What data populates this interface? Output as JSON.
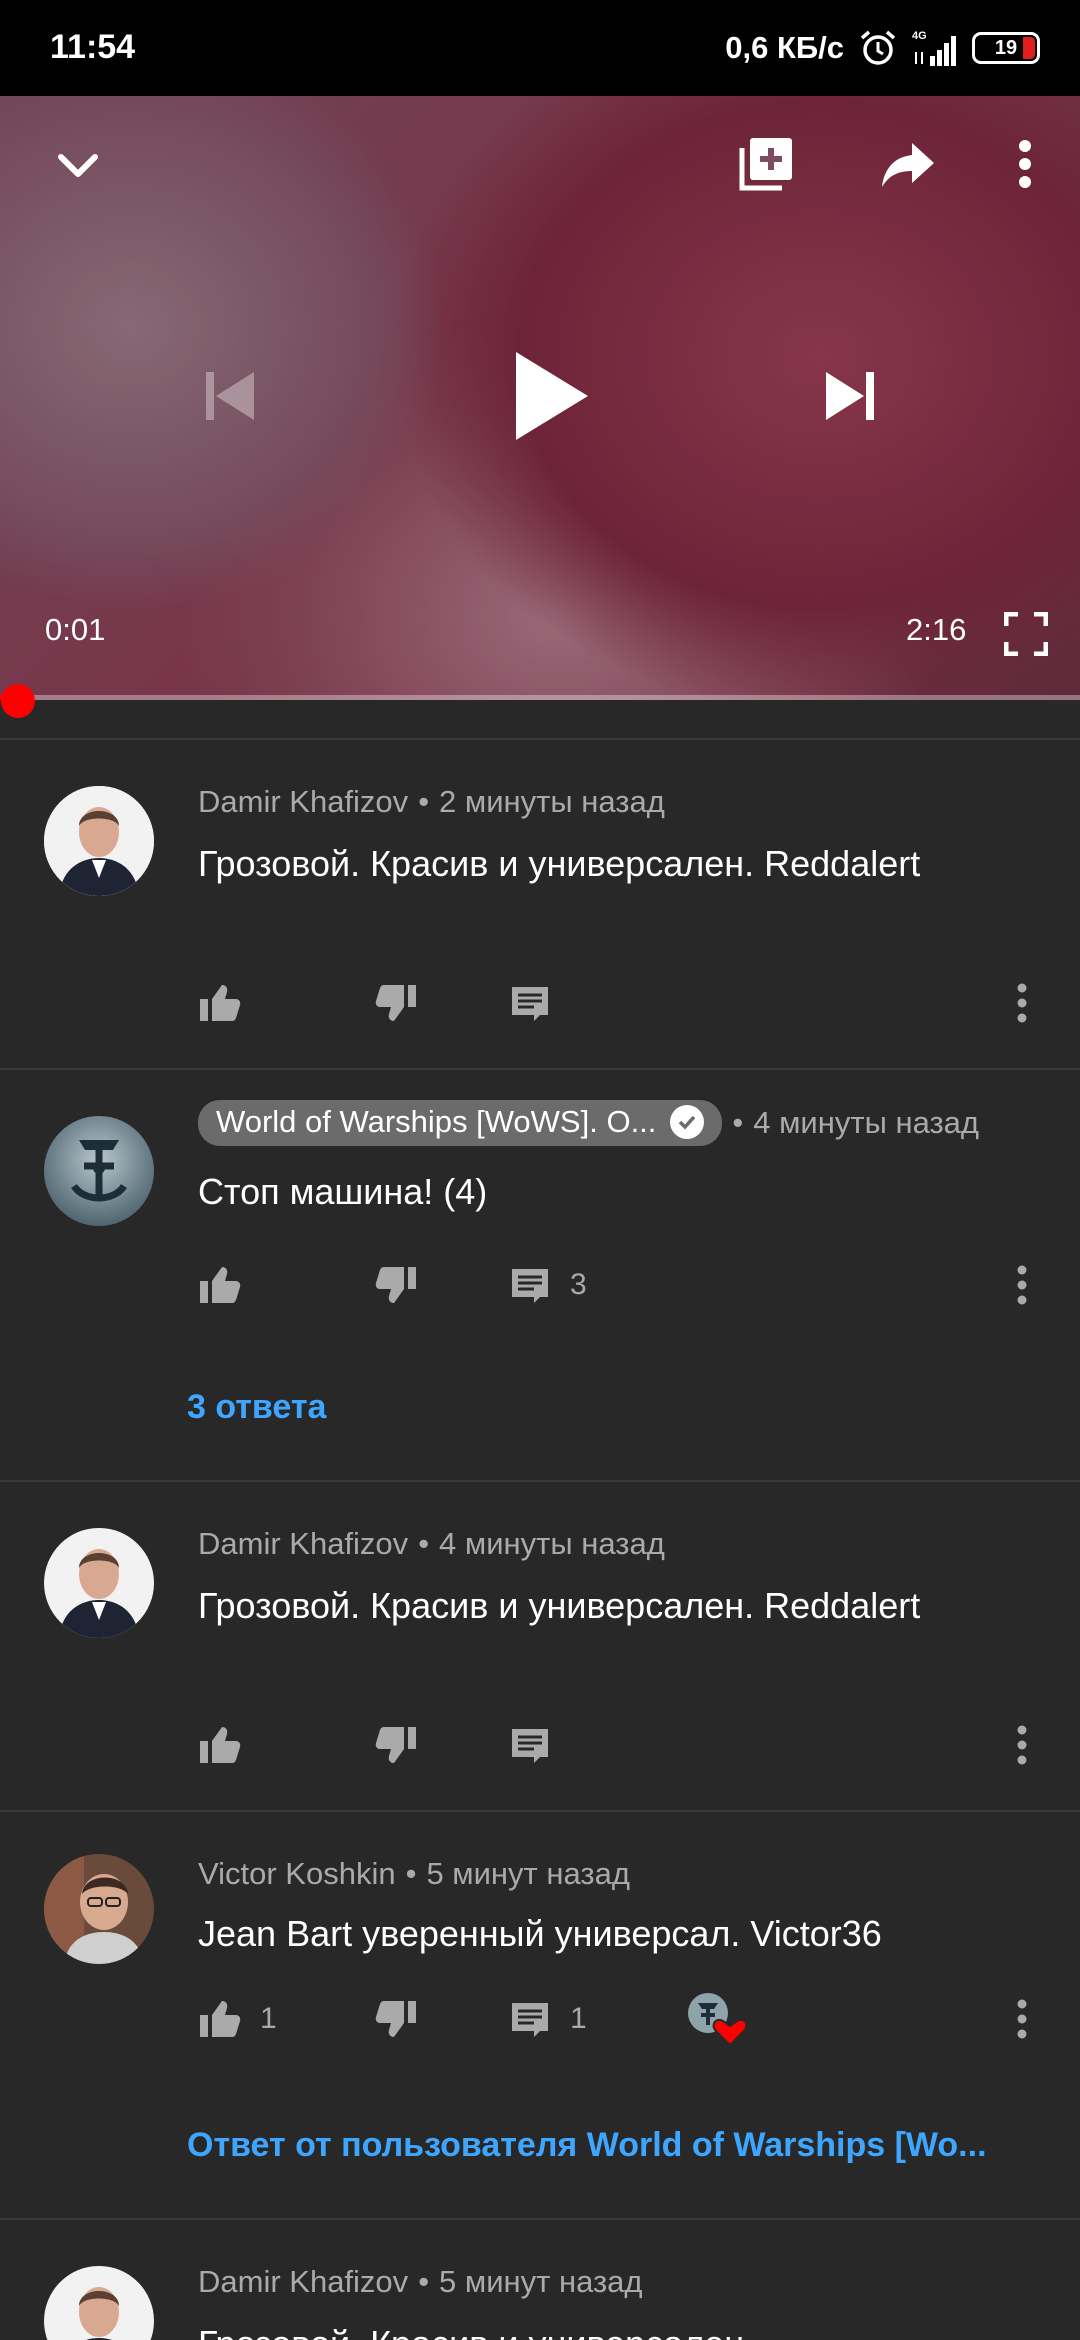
{
  "status_bar": {
    "time": "11:54",
    "network_speed": "0,6 КБ/с",
    "network_type": "4G",
    "battery_level": "19",
    "battery_fraction": 0.19,
    "alarm_icon": "alarm-icon",
    "signal_icon": "signal-icon"
  },
  "player": {
    "current_time": "0:01",
    "duration": "2:16",
    "progress_fraction": 0.007,
    "icons": [
      "chevron-down-icon",
      "add-to-playlist-icon",
      "share-icon",
      "more-vert-icon",
      "skip-previous-icon",
      "play-icon",
      "skip-next-icon",
      "fullscreen-icon"
    ]
  },
  "colors": {
    "background": "#282828",
    "link": "#3ea6ff",
    "progress": "#ff0000",
    "meta_text": "#aaaaaa"
  },
  "comments": [
    {
      "author": "Damir Khafizov",
      "time": "2 минуты назад",
      "text": "Грозовой. Красив и универсален. Reddalert",
      "likes": "",
      "replies": ""
    },
    {
      "author": "World of Warships [WoWS]. О...",
      "verified": true,
      "time": "4 минуты назад",
      "text": "Стоп машина! (4)",
      "likes": "",
      "replies": "3",
      "replies_link": "3 ответа"
    },
    {
      "author": "Damir Khafizov",
      "time": "4 минуты назад",
      "text": "Грозовой. Красив и универсален. Reddalert",
      "likes": "",
      "replies": ""
    },
    {
      "author": "Victor Koshkin",
      "time": "5 минут назад",
      "text": "Jean Bart уверенный универсал. Victor36",
      "likes": "1",
      "replies": "1",
      "creator_heart": true,
      "replies_link": "Ответ от пользователя World of Warships [Wo..."
    },
    {
      "author": "Damir Khafizov",
      "time": "5 минут назад",
      "text": "Грозовой. Красив и универсален."
    }
  ],
  "separator": "•"
}
